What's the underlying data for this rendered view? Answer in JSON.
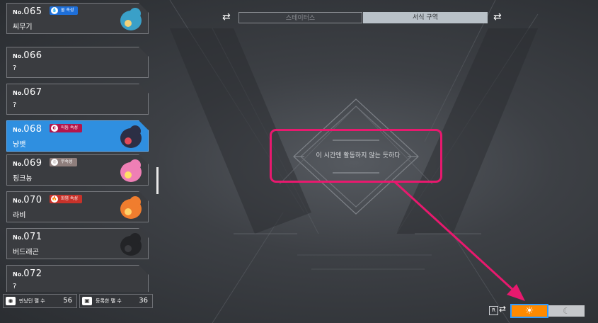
{
  "tabs": [
    {
      "label": "스테이터스",
      "active": false
    },
    {
      "label": "서식 구역",
      "active": true
    }
  ],
  "entries": [
    {
      "num_prefix": "No.",
      "num": "065",
      "name": "씨무기",
      "badge": "물 속성",
      "badge_icon": "💧",
      "badge_color": "#1e6fd9",
      "thumb": "blue-pal"
    },
    {
      "num_prefix": "No.",
      "num": "066",
      "name": "?"
    },
    {
      "num_prefix": "No.",
      "num": "067",
      "name": "?"
    },
    {
      "num_prefix": "No.",
      "num": "068",
      "name": "냥뱃",
      "badge": "어둠 속성",
      "badge_icon": "◐",
      "badge_color": "#b4164c",
      "thumb": "dark-cat-pal",
      "selected": true
    },
    {
      "num_prefix": "No.",
      "num": "069",
      "name": "핑크뇽",
      "badge": "무속성",
      "badge_icon": "◎",
      "badge_color": "#8e7e7c",
      "thumb": "pink-dragon-pal"
    },
    {
      "num_prefix": "No.",
      "num": "070",
      "name": "라비",
      "badge": "화염 속성",
      "badge_icon": "🔥",
      "badge_color": "#c8322a",
      "thumb": "fire-pal"
    },
    {
      "num_prefix": "No.",
      "num": "071",
      "name": "버드래곤",
      "thumb": "shadow-pal"
    },
    {
      "num_prefix": "No.",
      "num": "072",
      "name": "?"
    }
  ],
  "counters": {
    "met": {
      "label": "만났던 팰 수",
      "value": "56",
      "icon": "eye-icon"
    },
    "registered": {
      "label": "등록한 팰 수",
      "value": "36",
      "icon": "book-icon"
    }
  },
  "message": "이 시간엔 활동하지 않는 듯하다",
  "toggle": {
    "key": "R",
    "selected": "day"
  },
  "colors": {
    "highlight": "#e8196e",
    "selected_entry": "#2f8fe0",
    "day": "#ff8a00"
  }
}
